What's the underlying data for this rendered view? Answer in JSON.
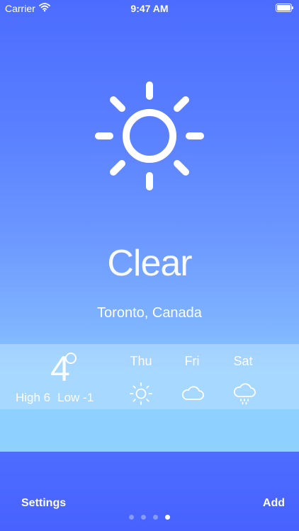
{
  "status_bar": {
    "carrier": "Carrier",
    "time": "9:47 AM"
  },
  "current": {
    "condition": "Clear",
    "location": "Toronto, Canada",
    "temperature": "4",
    "high_label": "High 6",
    "low_label": "Low -1",
    "icon": "sun-icon"
  },
  "forecast": [
    {
      "day": "Thu",
      "icon": "sun-icon"
    },
    {
      "day": "Fri",
      "icon": "cloud-icon"
    },
    {
      "day": "Sat",
      "icon": "rain-cloud-icon"
    }
  ],
  "bottom_bar": {
    "settings_label": "Settings",
    "add_label": "Add"
  },
  "pager": {
    "pages": 4,
    "active_index": 3
  },
  "colors": {
    "top": "#4C6CFF",
    "band": "#BEE1FF",
    "lower_band": "#8ED0FF",
    "bottom_bar": "#4762FF"
  }
}
